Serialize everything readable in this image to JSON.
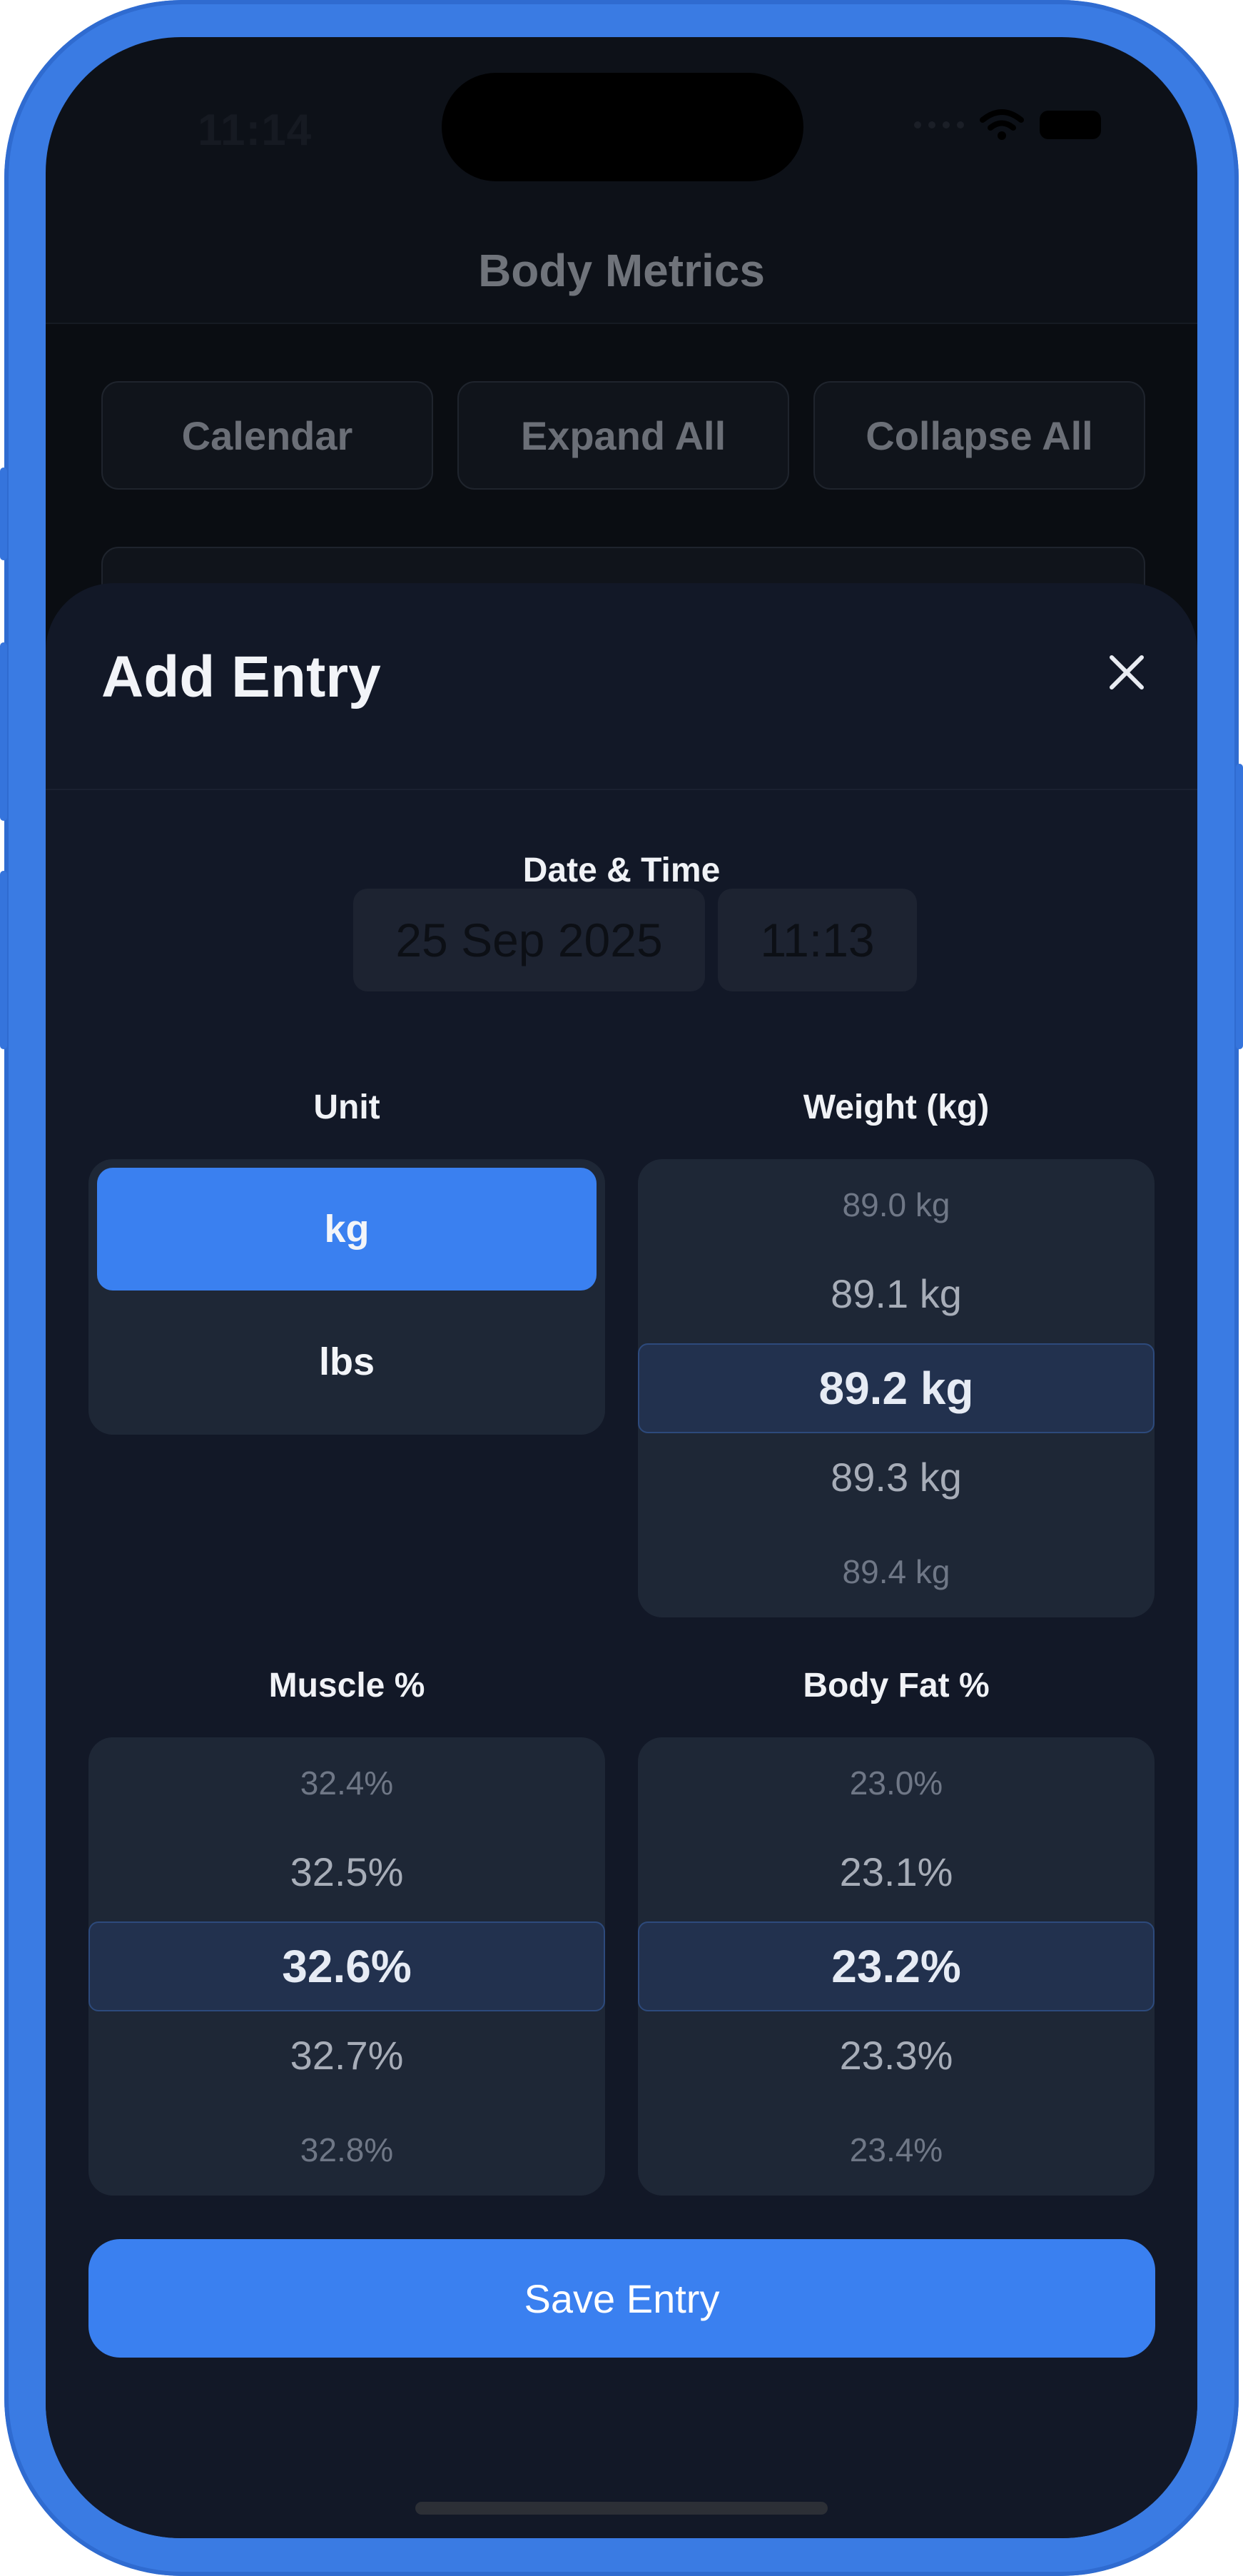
{
  "status_bar": {
    "time": "11:14",
    "icons": [
      "signal-icon",
      "wifi-icon",
      "battery-icon"
    ]
  },
  "background": {
    "nav_title": "Body Metrics",
    "buttons": [
      "Calendar",
      "Expand All",
      "Collapse All"
    ]
  },
  "sheet": {
    "title": "Add Entry",
    "close_icon": "close-icon",
    "date_time": {
      "label": "Date & Time",
      "date": "25 Sep 2025",
      "time": "11:13"
    },
    "unit": {
      "label": "Unit",
      "options": [
        "kg",
        "lbs"
      ],
      "selected": "kg"
    },
    "weight": {
      "label": "Weight (kg)",
      "values": [
        "89.0 kg",
        "89.1 kg",
        "89.2 kg",
        "89.3 kg",
        "89.4 kg"
      ],
      "selected": "89.2 kg"
    },
    "muscle": {
      "label": "Muscle %",
      "values": [
        "32.4%",
        "32.5%",
        "32.6%",
        "32.7%",
        "32.8%"
      ],
      "selected": "32.6%"
    },
    "body_fat": {
      "label": "Body Fat %",
      "values": [
        "23.0%",
        "23.1%",
        "23.2%",
        "23.3%",
        "23.4%"
      ],
      "selected": "23.2%"
    },
    "save_label": "Save Entry"
  },
  "colors": {
    "accent": "#3a80f0",
    "sheet_bg": "#121827",
    "picker_bg": "#1e2736",
    "frame": "#3a7be3"
  }
}
